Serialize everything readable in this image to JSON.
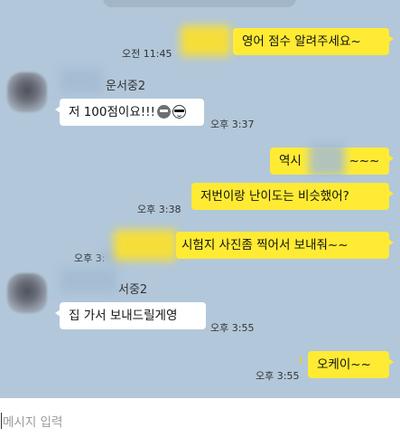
{
  "messages": [
    {
      "id": "m1",
      "dir": "out",
      "text": "영어 점수 알려주세요~",
      "time": "오전 11:45"
    },
    {
      "id": "m2",
      "dir": "in",
      "sender": "운서중2",
      "text": "저 100점이요!!!",
      "emoji": [
        "gray-face-icon",
        "sunglasses-face-icon"
      ],
      "time": "오후 3:37"
    },
    {
      "id": "m3",
      "dir": "out",
      "text": "역시",
      "suffix": "~~~"
    },
    {
      "id": "m4",
      "dir": "out",
      "text": "저번이랑 난이도는 비슷했어?",
      "time": "오후 3:38"
    },
    {
      "id": "m5",
      "dir": "out",
      "text": "시험지 사진좀 찍어서 보내줘~~",
      "time": "오후 3:"
    },
    {
      "id": "m6",
      "dir": "in",
      "sender": "서중2",
      "text": "집 가서 보내드릴게영",
      "time": "오후 3:55"
    },
    {
      "id": "m7",
      "dir": "out",
      "text": "오케이~~",
      "time": "오후 3:55",
      "read": "1"
    }
  ],
  "input": {
    "placeholder": "메시지 입력",
    "value": ""
  },
  "colors": {
    "chat_bg": "#b2c7da",
    "outgoing": "#ffeb33",
    "incoming": "#ffffff"
  }
}
